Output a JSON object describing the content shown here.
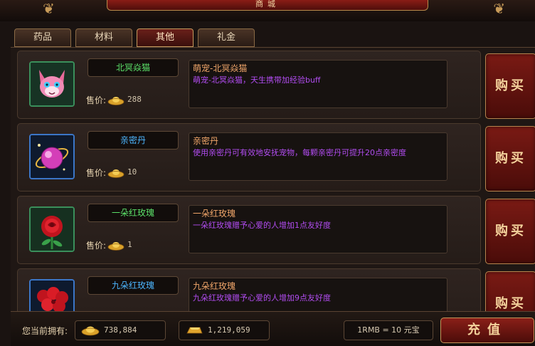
{
  "window": {
    "title": "商城"
  },
  "tabs": [
    {
      "label": "药品",
      "active": false
    },
    {
      "label": "材料",
      "active": false
    },
    {
      "label": "其他",
      "active": true
    },
    {
      "label": "礼金",
      "active": false
    }
  ],
  "price_label": "售价:",
  "buy_label": "购买",
  "items": [
    {
      "name": "北冥焱猫",
      "name_color": "green",
      "icon": "cat-pet-icon",
      "price": "288",
      "desc_title": "萌宠-北冥焱猫",
      "desc_text": "萌宠-北冥焱猫，天生携带加经验buff"
    },
    {
      "name": "亲密丹",
      "name_color": "blue",
      "icon": "pink-orb-icon",
      "price": "10",
      "desc_title": "亲密丹",
      "desc_text": "使用亲密丹可有效地安抚宠物，每颗亲密丹可提升20点亲密度"
    },
    {
      "name": "一朵红玫瑰",
      "name_color": "green",
      "icon": "rose-icon",
      "price": "1",
      "desc_title": "一朵红玫瑰",
      "desc_text": "一朵红玫瑰赠予心爱的人增加1点友好度"
    },
    {
      "name": "九朵红玫瑰",
      "name_color": "blue",
      "icon": "rose-bouquet-icon",
      "price": "",
      "desc_title": "九朵红玫瑰",
      "desc_text": "九朵红玫瑰赠予心爱的人增加9点友好度"
    }
  ],
  "footer": {
    "owned_label": "您当前拥有:",
    "ingot_amount": "738,884",
    "gold_amount": "1,219,059",
    "rate": "1RMB = 10 元宝",
    "recharge_label": "充值"
  },
  "colors": {
    "accent_red": "#7a1a14",
    "gold_trim": "#b8864e",
    "name_green": "#5ce36a",
    "name_blue": "#4cb6ff",
    "desc_purple": "#b14cf0",
    "desc_orange": "#f1a66a"
  }
}
